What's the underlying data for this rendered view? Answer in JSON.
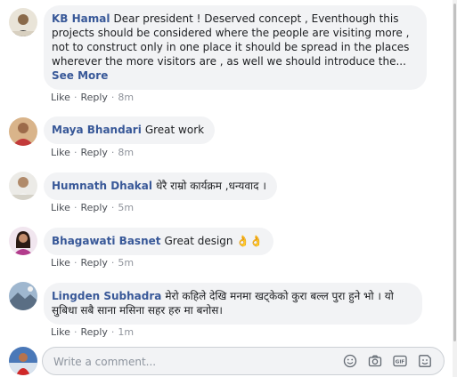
{
  "comments": [
    {
      "author": "KB Hamal",
      "text": "Dear president ! Deserved concept , Eventhough this projects should be considered where the people are visiting more , not to construct only in one place it should be spread in the places wherever the more visitors are , as well we should introduce the...",
      "see_more": "See More",
      "like": "Like",
      "reply": "Reply",
      "time": "8m"
    },
    {
      "author": "Maya Bhandari",
      "text": "Great work",
      "like": "Like",
      "reply": "Reply",
      "time": "8m"
    },
    {
      "author": "Humnath Dhakal",
      "text": "धेरै राम्रो कार्यक्रम ,धन्यवाद ।",
      "like": "Like",
      "reply": "Reply",
      "time": "5m"
    },
    {
      "author": "Bhagawati Basnet",
      "text": "Great design 👌👌",
      "like": "Like",
      "reply": "Reply",
      "time": "5m"
    },
    {
      "author": "Lingden Subhadra",
      "text": "मेरो कहिले देखि मनमा खट्केको कुरा बल्ल पुरा हुने भो । यो सुबिधा सबै साना मसिना सहर हरु मा बनोस।",
      "like": "Like",
      "reply": "Reply",
      "time": "1m"
    }
  ],
  "composer": {
    "placeholder": "Write a comment...",
    "tools": [
      "emoji-icon",
      "camera-icon",
      "gif-icon",
      "sticker-icon"
    ]
  },
  "colors": {
    "name_link": "#385898",
    "bubble_bg": "#f2f3f5",
    "meta_text": "#90949c"
  }
}
